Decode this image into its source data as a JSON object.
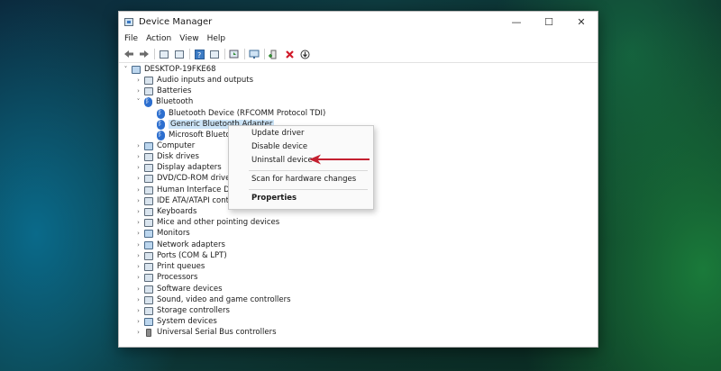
{
  "window": {
    "title": "Device Manager"
  },
  "window_controls": {
    "minimize": "—",
    "maximize": "☐",
    "close": "✕"
  },
  "menu": [
    "File",
    "Action",
    "View",
    "Help"
  ],
  "toolbar_icons": [
    "back-arrow-icon",
    "forward-arrow-icon",
    "show-hide-tree-icon",
    "properties-icon",
    "help-icon",
    "view-icon",
    "update-driver-icon",
    "monitor-icon",
    "add-driver-icon",
    "uninstall-x-icon",
    "download-icon"
  ],
  "colors": {
    "uninstall_red": "#d11a2a",
    "arrow_red": "#c42030",
    "selection": "#cce4f7",
    "bluetooth_blue": "#2d6fcf"
  },
  "tree": {
    "root": "DESKTOP-19FKE68",
    "items": [
      {
        "label": "Audio inputs and outputs",
        "caret": "›",
        "icon": "speaker-icon"
      },
      {
        "label": "Batteries",
        "caret": "›",
        "icon": "battery-icon"
      },
      {
        "label": "Bluetooth",
        "caret": "˅",
        "icon": "bluetooth-icon"
      },
      {
        "label": "Bluetooth Device (RFCOMM Protocol TDI)",
        "caret": "",
        "icon": "bluetooth-icon"
      },
      {
        "label": "Generic Bluetooth Adapter",
        "caret": "",
        "icon": "bluetooth-icon"
      },
      {
        "label": "Microsoft Bluetoo",
        "caret": "",
        "icon": "bluetooth-icon"
      },
      {
        "label": "Computer",
        "caret": "›",
        "icon": "computer-icon"
      },
      {
        "label": "Disk drives",
        "caret": "›",
        "icon": "disk-icon"
      },
      {
        "label": "Display adapters",
        "caret": "›",
        "icon": "display-icon"
      },
      {
        "label": "DVD/CD-ROM drives",
        "caret": "›",
        "icon": "dvd-icon"
      },
      {
        "label": "Human Interface Devic",
        "caret": "›",
        "icon": "hid-icon"
      },
      {
        "label": "IDE ATA/ATAPI contro",
        "caret": "›",
        "icon": "ide-icon"
      },
      {
        "label": "Keyboards",
        "caret": "›",
        "icon": "keyboard-icon"
      },
      {
        "label": "Mice and other pointing devices",
        "caret": "›",
        "icon": "mouse-icon"
      },
      {
        "label": "Monitors",
        "caret": "›",
        "icon": "monitor-icon"
      },
      {
        "label": "Network adapters",
        "caret": "›",
        "icon": "network-icon"
      },
      {
        "label": "Ports (COM & LPT)",
        "caret": "›",
        "icon": "port-icon"
      },
      {
        "label": "Print queues",
        "caret": "›",
        "icon": "printer-icon"
      },
      {
        "label": "Processors",
        "caret": "›",
        "icon": "processor-icon"
      },
      {
        "label": "Software devices",
        "caret": "›",
        "icon": "software-icon"
      },
      {
        "label": "Sound, video and game controllers",
        "caret": "›",
        "icon": "sound-icon"
      },
      {
        "label": "Storage controllers",
        "caret": "›",
        "icon": "storage-icon"
      },
      {
        "label": "System devices",
        "caret": "›",
        "icon": "system-icon"
      },
      {
        "label": "Universal Serial Bus controllers",
        "caret": "›",
        "icon": "usb-icon"
      }
    ]
  },
  "context_menu": {
    "update_driver": "Update driver",
    "disable_device": "Disable device",
    "uninstall_device": "Uninstall device",
    "scan_changes": "Scan for hardware changes",
    "properties": "Properties"
  }
}
